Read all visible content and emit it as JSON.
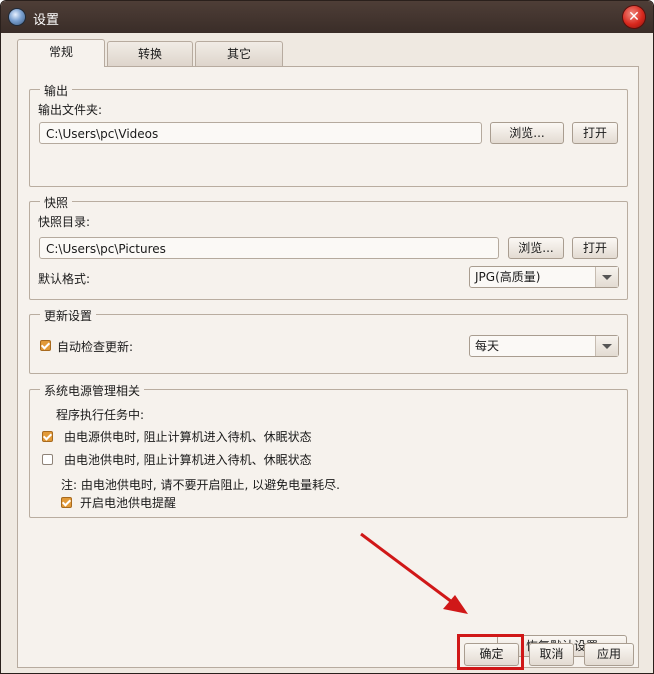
{
  "window": {
    "title": "设置"
  },
  "tabs": [
    {
      "label": "常规",
      "active": true
    },
    {
      "label": "转换",
      "active": false
    },
    {
      "label": "其它",
      "active": false
    }
  ],
  "output": {
    "legend": "输出",
    "folder_label": "输出文件夹:",
    "folder_value": "C:\\Users\\pc\\Videos",
    "browse_label": "浏览...",
    "open_label": "打开"
  },
  "snapshot": {
    "legend": "快照",
    "dir_label": "快照目录:",
    "dir_value": "C:\\Users\\pc\\Pictures",
    "browse_label": "浏览...",
    "open_label": "打开",
    "format_label": "默认格式:",
    "format_value": "JPG(高质量)"
  },
  "update": {
    "legend": "更新设置",
    "auto_check_label": "自动检查更新:",
    "auto_check_checked": true,
    "frequency_value": "每天"
  },
  "power": {
    "legend": "系统电源管理相关",
    "task_label": "程序执行任务中:",
    "ac_label": "由电源供电时, 阻止计算机进入待机、休眠状态",
    "ac_checked": true,
    "battery_label": "由电池供电时, 阻止计算机进入待机、休眠状态",
    "battery_checked": false,
    "note": "注: 由电池供电时, 请不要开启阻止, 以避免电量耗尽.",
    "battery_alert_label": "开启电池供电提醒",
    "battery_alert_checked": true
  },
  "buttons": {
    "restore_defaults": "恢复默认设置",
    "ok": "确定",
    "cancel": "取消",
    "apply": "应用"
  },
  "colors": {
    "highlight": "#d01818",
    "checkbox_accent": "#e29a38",
    "titlebar": "#3a2d28"
  }
}
